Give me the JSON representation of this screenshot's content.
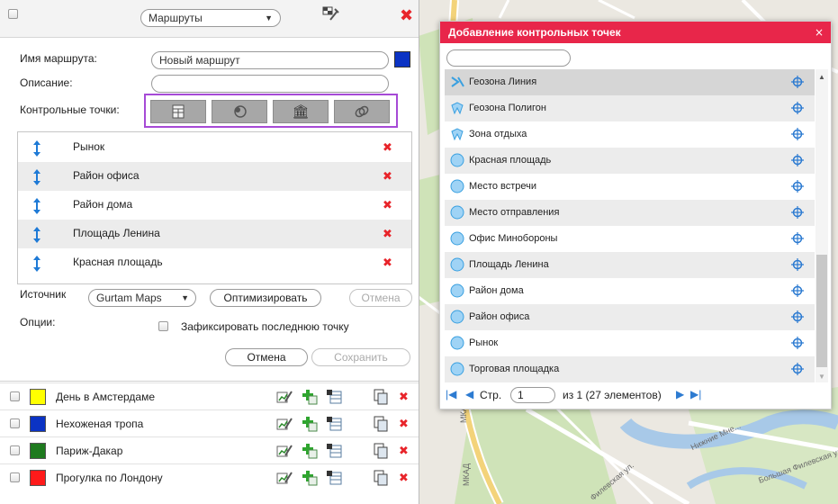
{
  "header": {
    "section_select": "Маршруты"
  },
  "form": {
    "route_name_label": "Имя маршрута:",
    "route_name_value": "Новый маршрут",
    "route_color": "#0b33c4",
    "description_label": "Описание:",
    "description_value": "",
    "checkpoints_label": "Контрольные точки:"
  },
  "points": [
    {
      "name": "Рынок"
    },
    {
      "name": "Район офиса"
    },
    {
      "name": "Район дома"
    },
    {
      "name": "Площадь Ленина"
    },
    {
      "name": "Красная площадь"
    }
  ],
  "source": {
    "label": "Источник",
    "value": "Gurtam Maps",
    "optimize_label": "Оптимизировать",
    "cancel_label": "Отмена"
  },
  "options": {
    "label": "Опции:",
    "fix_last_label": "Зафиксировать последнюю точку"
  },
  "actions": {
    "cancel_label": "Отмена",
    "save_label": "Сохранить"
  },
  "routes": [
    {
      "name": "День в Амстердаме",
      "color": "#ffff00"
    },
    {
      "name": "Нехоженая тропа",
      "color": "#0b33c4"
    },
    {
      "name": "Париж-Дакар",
      "color": "#1e7a1e"
    },
    {
      "name": "Прогулка по Лондону",
      "color": "#ff1a1a"
    }
  ],
  "dialog": {
    "title": "Добавление контрольных точек",
    "close": "×",
    "search_placeholder": "",
    "items": [
      {
        "name": "Геозона Линия",
        "icon": "geozone-line-icon",
        "selected": true
      },
      {
        "name": "Геозона Полигон",
        "icon": "geozone-polygon-icon"
      },
      {
        "name": "Зона отдыха",
        "icon": "geozone-polygon-icon"
      },
      {
        "name": "Красная площадь",
        "icon": "geozone-circle-icon"
      },
      {
        "name": "Место встречи",
        "icon": "geozone-circle-icon"
      },
      {
        "name": "Место отправления",
        "icon": "geozone-circle-icon"
      },
      {
        "name": "Офис Минобороны",
        "icon": "geozone-circle-icon"
      },
      {
        "name": "Площадь Ленина",
        "icon": "geozone-circle-icon"
      },
      {
        "name": "Район дома",
        "icon": "geozone-circle-icon"
      },
      {
        "name": "Район офиса",
        "icon": "geozone-circle-icon"
      },
      {
        "name": "Рынок",
        "icon": "geozone-circle-icon"
      },
      {
        "name": "Торговая площадка",
        "icon": "geozone-circle-icon"
      }
    ],
    "pager": {
      "page_label": "Стр.",
      "page_value": "1",
      "of_text": "из 1 (27 элементов)"
    }
  },
  "map": {
    "labels": [
      "МКАД",
      "МКАД",
      "Нижние Мне...",
      "Большая Филевская ул.",
      "Филевская ул."
    ]
  }
}
